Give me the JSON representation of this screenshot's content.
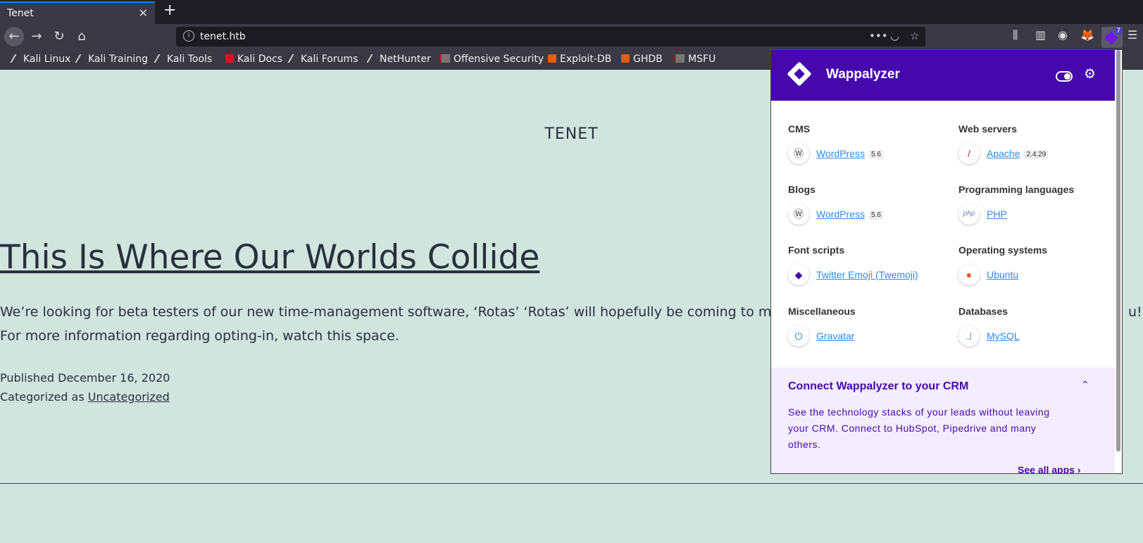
{
  "browser": {
    "tab": {
      "title": "Tenet"
    },
    "url": "tenet.htb",
    "extension_badge": "7",
    "bookmarks": [
      {
        "label": "Kali Linux",
        "icon": "kali-dragon-icon"
      },
      {
        "label": "Kali Training",
        "icon": "kali-dragon-icon"
      },
      {
        "label": "Kali Tools",
        "icon": "kali-dragon-icon"
      },
      {
        "label": "Kali Docs",
        "icon": "docs-icon"
      },
      {
        "label": "Kali Forums",
        "icon": "kali-dragon-icon"
      },
      {
        "label": "NetHunter",
        "icon": "kali-dragon-icon"
      },
      {
        "label": "Offensive Security",
        "icon": "offsec-icon"
      },
      {
        "label": "Exploit-DB",
        "icon": "exploit-db-icon"
      },
      {
        "label": "GHDB",
        "icon": "exploit-db-icon"
      },
      {
        "label": "MSFU",
        "icon": "offsec-icon"
      }
    ]
  },
  "page": {
    "site_title": "TENET",
    "post_title": "This Is Where Our Worlds Collide",
    "body_line1": "We’re looking for beta testers of our new time-management software, ‘Rotas’ ‘Rotas’ will hopefully be coming to market late",
    "body_line1_tail": "u!",
    "body_line2": "For more information regarding opting-in, watch this space.",
    "published": "Published December 16, 2020",
    "categorized_prefix": "Categorized as",
    "category": "Uncategorized"
  },
  "wappalyzer": {
    "name": "Wappalyzer",
    "categories": [
      {
        "name": "CMS",
        "tech": "WordPress",
        "version": "5.6",
        "icon": "wordpress-icon"
      },
      {
        "name": "Web servers",
        "tech": "Apache",
        "version": "2.4.29",
        "icon": "apache-feather-icon"
      },
      {
        "name": "Blogs",
        "tech": "WordPress",
        "version": "5.6",
        "icon": "wordpress-icon"
      },
      {
        "name": "Programming languages",
        "tech": "PHP",
        "version": "",
        "icon": "php-icon"
      },
      {
        "name": "Font scripts",
        "tech": "Twitter Emoji (Twemoji)",
        "version": "",
        "icon": "twemoji-icon"
      },
      {
        "name": "Operating systems",
        "tech": "Ubuntu",
        "version": "",
        "icon": "ubuntu-icon"
      },
      {
        "name": "Miscellaneous",
        "tech": "Gravatar",
        "version": "",
        "icon": "gravatar-icon"
      },
      {
        "name": "Databases",
        "tech": "MySQL",
        "version": "",
        "icon": "mysql-icon"
      }
    ],
    "crm": {
      "title": "Connect Wappalyzer to your CRM",
      "text": "See the technology stacks of your leads without leaving your CRM. Connect to HubSpot, Pipedrive and many others.",
      "link": "See all apps"
    },
    "colors": {
      "brand": "#4608ad",
      "link": "#2e89e8"
    }
  }
}
